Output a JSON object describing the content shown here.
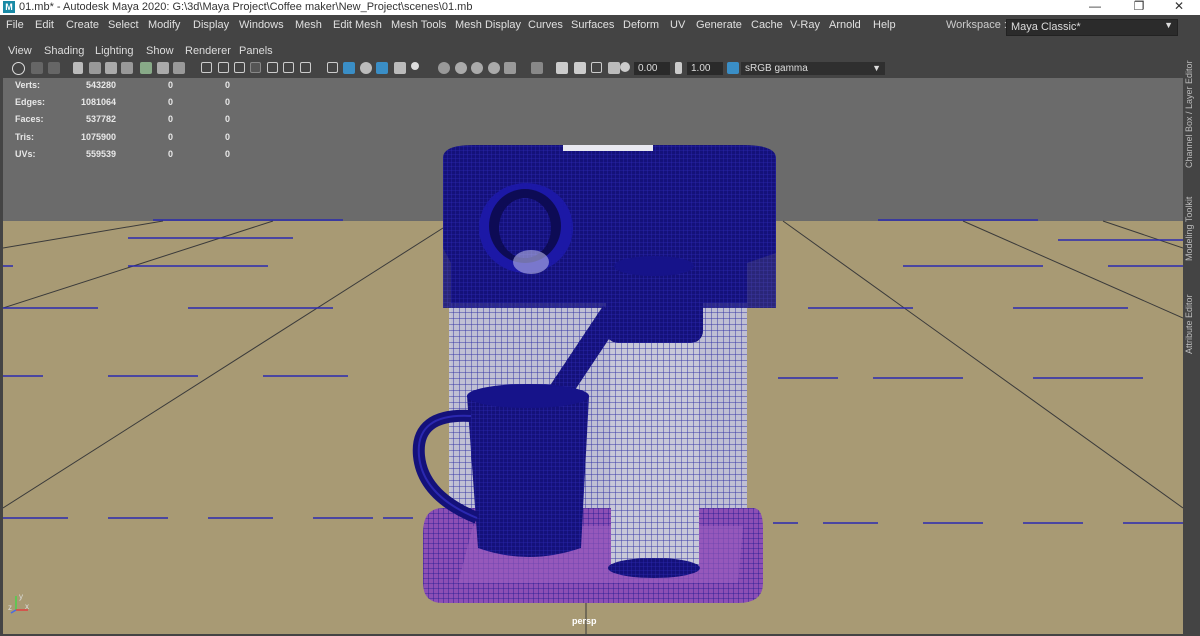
{
  "window": {
    "title": "01.mb* - Autodesk Maya 2020: G:\\3d\\Maya Project\\Coffee maker\\New_Project\\scenes\\01.mb",
    "logo": "M",
    "minimize": "—",
    "restore": "❐",
    "close": "✕"
  },
  "menubar": {
    "items": [
      "File",
      "Edit",
      "Create",
      "Select",
      "Modify",
      "Display",
      "Windows",
      "Mesh",
      "Edit Mesh",
      "Mesh Tools",
      "Mesh Display",
      "Curves",
      "Surfaces",
      "Deform",
      "UV",
      "Generate",
      "Cache",
      "V-Ray",
      "Arnold",
      "Help"
    ],
    "workspace_label": "Workspace :",
    "workspace_value": "Maya Classic*"
  },
  "panel_menu": {
    "items": [
      "View",
      "Shading",
      "Lighting",
      "Show",
      "Renderer",
      "Panels"
    ]
  },
  "toolbar": {
    "field1": "0.00",
    "field2": "1.00",
    "colorspace": "sRGB gamma"
  },
  "hud": {
    "rows": [
      {
        "label": "Verts:",
        "v1": "543280",
        "v2": "0",
        "v3": "0"
      },
      {
        "label": "Edges:",
        "v1": "1081064",
        "v2": "0",
        "v3": "0"
      },
      {
        "label": "Faces:",
        "v1": "537782",
        "v2": "0",
        "v3": "0"
      },
      {
        "label": "Tris:",
        "v1": "1075900",
        "v2": "0",
        "v3": "0"
      },
      {
        "label": "UVs:",
        "v1": "559539",
        "v2": "0",
        "v3": "0"
      }
    ]
  },
  "side_tabs": [
    "Channel Box / Layer Editor",
    "Modeling Toolkit",
    "Attribute Editor"
  ],
  "camera_label": "persp",
  "axis": {
    "y": "y",
    "x": "x",
    "z": "z"
  },
  "colors": {
    "menubar_bg": "#444444",
    "viewport_bg": "#6b6b6b",
    "ground": "#a89a74",
    "mesh_blue": "#1d1a8c",
    "mesh_pink": "#c07ad8"
  }
}
